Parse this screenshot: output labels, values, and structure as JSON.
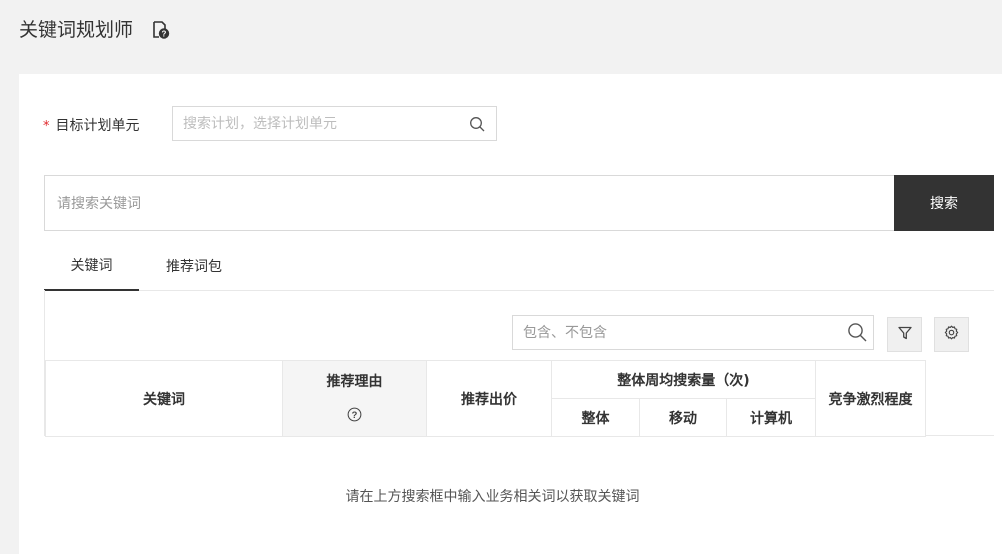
{
  "page": {
    "title": "关键词规划师"
  },
  "form": {
    "unit_required_mark": "*",
    "unit_label": "目标计划单元",
    "unit_placeholder": "搜索计划，选择计划单元"
  },
  "keyword_search": {
    "placeholder": "请搜索关键词",
    "button_label": "搜索"
  },
  "tabs": [
    {
      "label": "关键词",
      "active": true
    },
    {
      "label": "推荐词包",
      "active": false
    }
  ],
  "table": {
    "filter_placeholder": "包含、不包含",
    "columns": {
      "keyword": "关键词",
      "reason": "推荐理由",
      "bid": "推荐出价",
      "weekly_volume": "整体周均搜索量（次)",
      "volume_total": "整体",
      "volume_mobile": "移动",
      "volume_pc": "计算机",
      "competition": "竞争激烈程度"
    },
    "empty_message": "请在上方搜索框中输入业务相关词以获取关键词"
  },
  "icons": {
    "help_doc": "help-document-icon",
    "search": "search-icon",
    "filter": "filter-funnel-icon",
    "settings": "gear-icon",
    "question": "question-circle-icon"
  },
  "colors": {
    "background": "#f2f2f2",
    "card": "#ffffff",
    "primary_button": "#333333",
    "required": "#e0272b"
  }
}
